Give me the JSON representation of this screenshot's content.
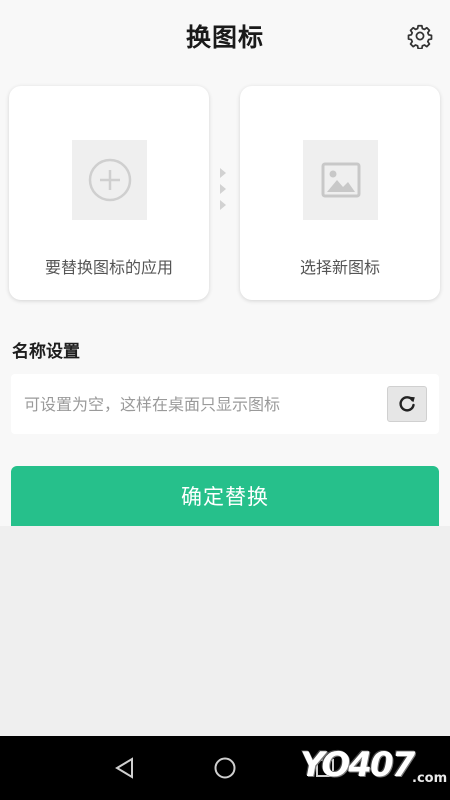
{
  "header": {
    "title": "换图标",
    "settings_icon": "gear-icon"
  },
  "cards": {
    "source_app": {
      "label": "要替换图标的应用",
      "icon": "add-circle-icon"
    },
    "new_icon": {
      "label": "选择新图标",
      "icon": "image-icon"
    }
  },
  "name_settings": {
    "title": "名称设置",
    "input_value": "",
    "input_placeholder": "可设置为空，这样在桌面只显示图标",
    "reset_icon": "refresh-icon"
  },
  "confirm_button": {
    "label": "确定替换"
  },
  "colors": {
    "accent": "#26c08b",
    "page_bg": "#f8f8f8",
    "card_bg": "#ffffff",
    "navbar_bg": "#000000"
  },
  "navbar": {
    "back_icon": "back-triangle-icon",
    "home_icon": "home-circle-icon",
    "recents_icon": "recents-square-icon"
  },
  "watermark": {
    "text": "YO407",
    "domain": ".com"
  }
}
